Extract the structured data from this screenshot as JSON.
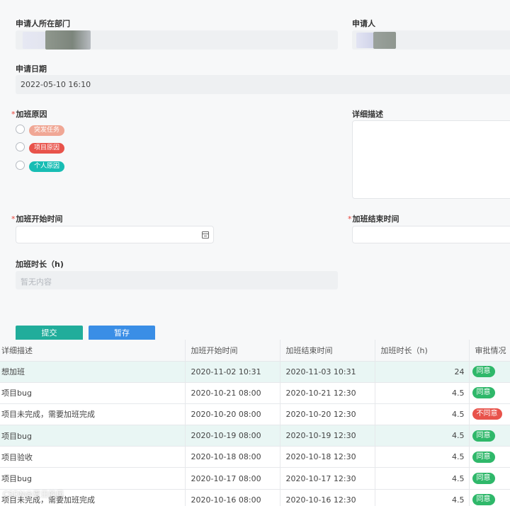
{
  "form": {
    "dept_label": "申请人所在部门",
    "applicant_label": "申请人",
    "date_label": "申请日期",
    "date_value": "2022-05-10 16:10",
    "reason_label": "加班原因",
    "reason_required": "*",
    "reason_options": [
      {
        "label": "突发任务",
        "color": "#f0a795"
      },
      {
        "label": "项目原因",
        "color": "#e8534b"
      },
      {
        "label": "个人原因",
        "color": "#18bdb4"
      }
    ],
    "description_label": "详细描述",
    "start_label": "加班开始时间",
    "start_required": "*",
    "end_label": "加班结束时间",
    "end_required": "*",
    "duration_label": "加班时长（h)",
    "duration_placeholder": "暂无内容",
    "calendar_icon": "calendar-icon"
  },
  "actions": {
    "submit_label": "提交",
    "submit_color": "#21ad9b",
    "draft_label": "暂存",
    "draft_color": "#3a8ee6"
  },
  "table": {
    "headers": [
      "详细描述",
      "加班开始时间",
      "加班结束时间",
      "加班时长（h)",
      "审批情况"
    ],
    "rows": [
      {
        "desc": "想加班",
        "start": "2020-11-02 10:31",
        "end": "2020-11-03 10:31",
        "hours": "24",
        "status": "同意",
        "highlight": true
      },
      {
        "desc": "项目bug",
        "start": "2020-10-21 08:00",
        "end": "2020-10-21 12:30",
        "hours": "4.5",
        "status": "同意",
        "highlight": false
      },
      {
        "desc": "项目未完成，需要加班完成",
        "start": "2020-10-20 08:00",
        "end": "2020-10-20 12:30",
        "hours": "4.5",
        "status": "不同意",
        "highlight": false
      },
      {
        "desc": "项目bug",
        "start": "2020-10-19 08:00",
        "end": "2020-10-19 12:30",
        "hours": "4.5",
        "status": "同意",
        "highlight": true
      },
      {
        "desc": "项目验收",
        "start": "2020-10-18 08:00",
        "end": "2020-10-18 12:30",
        "hours": "4.5",
        "status": "同意",
        "highlight": false
      },
      {
        "desc": "项目bug",
        "start": "2020-10-17 08:00",
        "end": "2020-10-17 12:30",
        "hours": "4.5",
        "status": "同意",
        "highlight": false
      },
      {
        "desc": "项目未完成，需要加班完成",
        "start": "2020-10-16 08:00",
        "end": "2020-10-16 12:30",
        "hours": "4.5",
        "status": "同意",
        "highlight": false
      }
    ],
    "status_colors": {
      "同意": "#2fb86a",
      "不同意": "#e8534b"
    },
    "highlight_color": "#e9f6f4"
  },
  "watermark": "CSDN@夏日的风"
}
